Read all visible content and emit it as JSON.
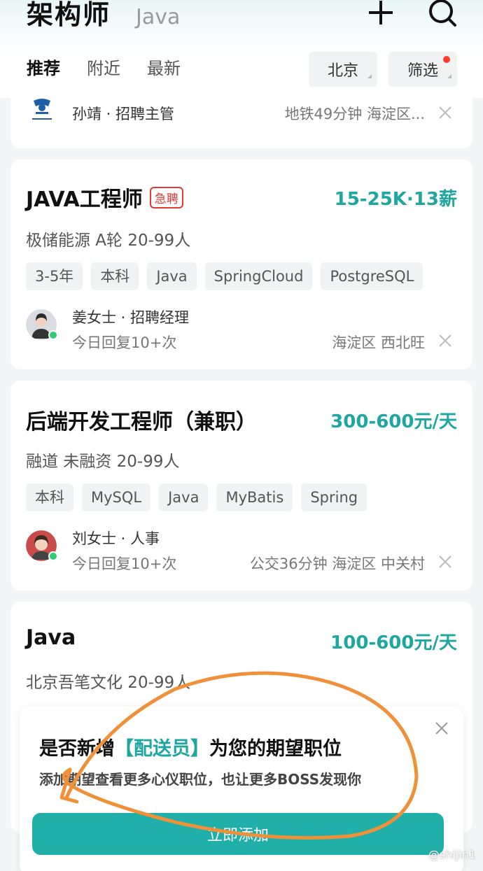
{
  "header": {
    "title": "架构师",
    "subtitle": "Java",
    "tabs": [
      "推荐",
      "附近",
      "最新"
    ],
    "city": "北京",
    "filter": "筛选"
  },
  "jobs": [
    {
      "recruiter": "孙靖 · 招聘主管",
      "location": "地铁49分钟  海淀区..."
    },
    {
      "title": "JAVA工程师",
      "badge": "急聘",
      "salary": "15-25K·13薪",
      "company": "极储能源  A轮  20-99人",
      "tags": [
        "3-5年",
        "本科",
        "Java",
        "SpringCloud",
        "PostgreSQL"
      ],
      "recruiter": "姜女士 · 招聘经理",
      "reply": "今日回复10+次",
      "location": "海淀区  西北旺"
    },
    {
      "title": "后端开发工程师（兼职）",
      "salary": "300-600元/天",
      "company": "融道  未融资  20-99人",
      "tags": [
        "本科",
        "MySQL",
        "Java",
        "MyBatis",
        "Spring"
      ],
      "recruiter": "刘女士 · 人事",
      "reply": "今日回复10+次",
      "location": "公交36分钟  海淀区  中关村"
    },
    {
      "title": "Java",
      "salary": "100-600元/天",
      "company": "北京吾笔文化  20-99人"
    }
  ],
  "popup": {
    "title_prefix": "是否新增",
    "title_highlight": "【配送员】",
    "title_suffix": "为您的期望职位",
    "subtitle": "添加期望查看更多心仪职位，也让更多BOSS发现你",
    "button": "立即添加"
  },
  "watermark": "@shijin1",
  "colors": {
    "accent": "#1ea6a0",
    "button": "#20b0a9",
    "urgent": "#e53935",
    "annotation": "#f0913a"
  }
}
